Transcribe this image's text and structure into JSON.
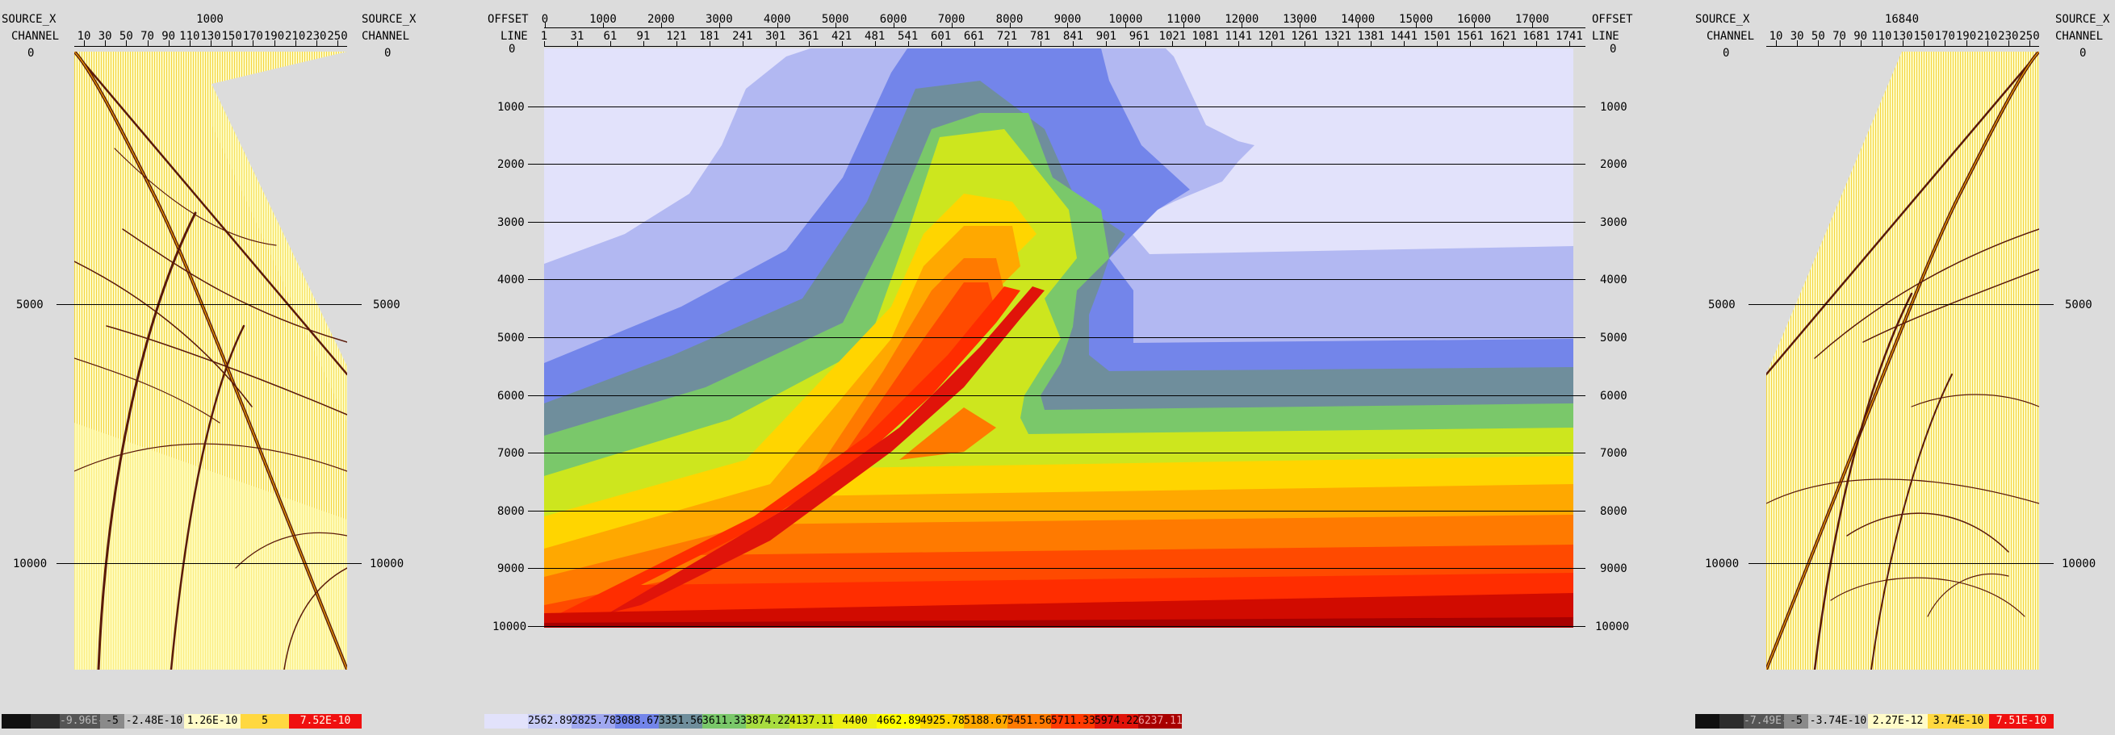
{
  "left_panel": {
    "hdr_source_x": "SOURCE_X",
    "hdr_channel": "CHANNEL",
    "hdr_zero": "0",
    "hdr_source_x_r": "SOURCE_X",
    "hdr_channel_r": "CHANNEL",
    "hdr_zero_r": "0",
    "source_value": "1000",
    "channel_ticks": [
      "10",
      "30",
      "50",
      "70",
      "90",
      "110",
      "130",
      "150",
      "170",
      "190",
      "210",
      "230",
      "250"
    ],
    "time_labels": [
      "5000",
      "10000"
    ],
    "legend": [
      "-9.96E-10",
      "-5",
      "-2.48E-10",
      "1.26E-10",
      "5",
      "7.52E-10"
    ]
  },
  "center_panel": {
    "hdr_offset": "OFFSET",
    "hdr_line": "LINE",
    "hdr_offset_r": "OFFSET",
    "hdr_line_r": "LINE",
    "offset_ticks": [
      "0",
      "1000",
      "2000",
      "3000",
      "4000",
      "5000",
      "6000",
      "7000",
      "8000",
      "9000",
      "10000",
      "11000",
      "12000",
      "13000",
      "14000",
      "15000",
      "16000",
      "17000"
    ],
    "line_ticks": [
      "1",
      "31",
      "61",
      "91",
      "121",
      "181",
      "241",
      "301",
      "361",
      "421",
      "481",
      "541",
      "601",
      "661",
      "721",
      "781",
      "841",
      "901",
      "961",
      "1021",
      "1081",
      "1141",
      "1201",
      "1261",
      "1321",
      "1381",
      "1441",
      "1501",
      "1561",
      "1621",
      "1681",
      "1741"
    ],
    "depth_labels": [
      "0",
      "1000",
      "2000",
      "3000",
      "4000",
      "5000",
      "6000",
      "7000",
      "8000",
      "9000",
      "10000"
    ],
    "legend": [
      "2562.89",
      "2825.78",
      "3088.67",
      "3351.56",
      "3611.33",
      "3874.22",
      "4137.11",
      "4400",
      "4662.89",
      "4925.78",
      "5188.67",
      "5451.56",
      "5711.33",
      "5974.22",
      "6237.11"
    ],
    "colors": [
      "#e2e2fb",
      "#b2b8f2",
      "#a0a8f0",
      "#6e82e8",
      "#6f8e9c",
      "#7ac86a",
      "#cde61e",
      "#ffff00",
      "#ffd500",
      "#ffa800",
      "#ff7a00",
      "#ff5500",
      "#ff2d00",
      "#e0140a",
      "#c80000",
      "#a80000"
    ]
  },
  "right_panel": {
    "hdr_source_x": "SOURCE_X",
    "hdr_channel": "CHANNEL",
    "hdr_zero": "0",
    "hdr_source_x_r": "SOURCE_X",
    "hdr_channel_r": "CHANNEL",
    "hdr_zero_r": "0",
    "source_value": "16840",
    "channel_ticks": [
      "10",
      "30",
      "50",
      "70",
      "90",
      "110",
      "130",
      "150",
      "170",
      "190",
      "210",
      "230",
      "250"
    ],
    "time_labels": [
      "5000",
      "10000"
    ],
    "legend": [
      "-7.49E-10",
      "-5",
      "-3.74E-10",
      "2.27E-12",
      "3.74E-10",
      "7.51E-10"
    ]
  }
}
